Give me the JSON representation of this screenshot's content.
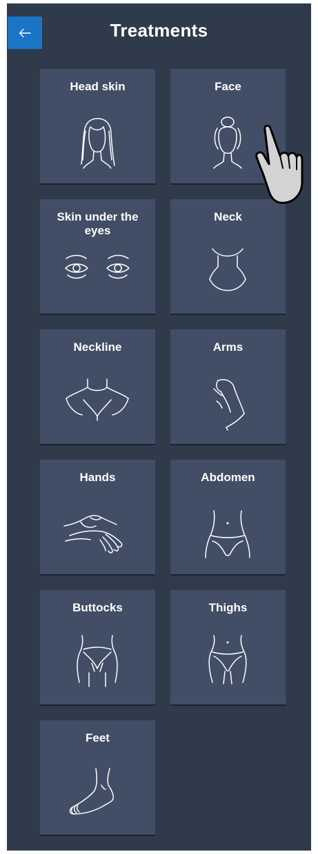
{
  "header": {
    "title": "Treatments",
    "back_icon": "arrow-left-icon"
  },
  "colors": {
    "background": "#2f3a4b",
    "tile": "#414e66",
    "accent": "#1a75c6",
    "text": "#ffffff"
  },
  "treatments": [
    {
      "label": "Head skin",
      "icon": "head-skin-icon"
    },
    {
      "label": "Face",
      "icon": "face-icon"
    },
    {
      "label": "Skin under the eyes",
      "icon": "under-eyes-icon"
    },
    {
      "label": "Neck",
      "icon": "neck-icon"
    },
    {
      "label": "Neckline",
      "icon": "neckline-icon"
    },
    {
      "label": "Arms",
      "icon": "arm-icon"
    },
    {
      "label": "Hands",
      "icon": "hands-icon"
    },
    {
      "label": "Abdomen",
      "icon": "abdomen-icon"
    },
    {
      "label": "Buttocks",
      "icon": "buttocks-icon"
    },
    {
      "label": "Thighs",
      "icon": "thighs-icon"
    },
    {
      "label": "Feet",
      "icon": "foot-icon"
    }
  ]
}
